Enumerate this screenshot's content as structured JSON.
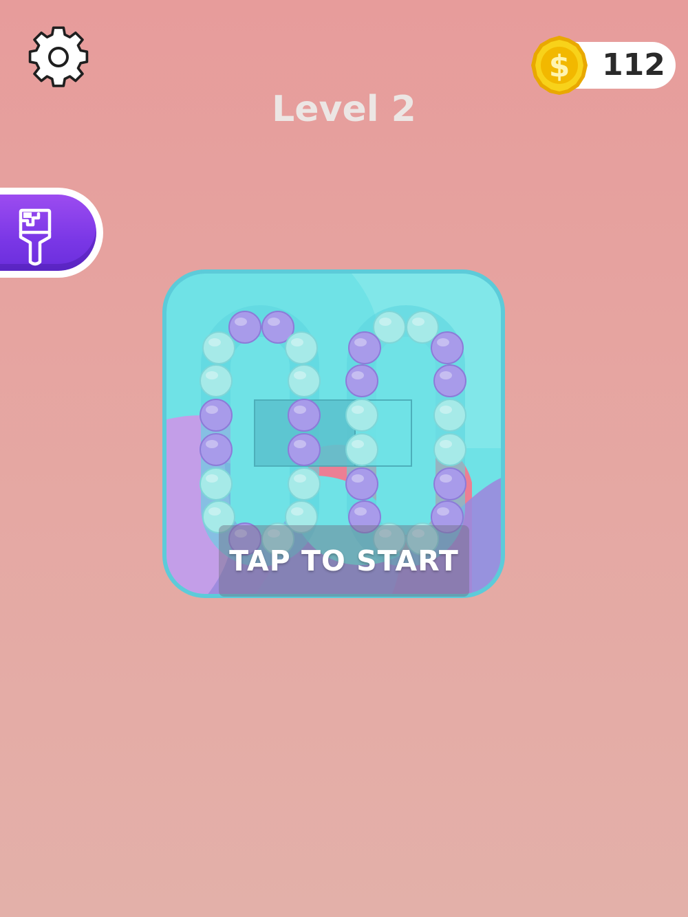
{
  "header": {
    "settings_icon": "gear-icon",
    "coins": "112",
    "coin_icon": "dollar-coin-icon",
    "level_title": "Level 2"
  },
  "skin_button": {
    "icon": "paint-brush-icon"
  },
  "board": {
    "ball_colors": {
      "purple": "#a89bea",
      "teal": "#a6eae8"
    }
  },
  "start": {
    "label": "TAP TO START"
  },
  "colors": {
    "background": "#e79c9b",
    "skin_button": "#8a40ec",
    "board_teal": "#6fe2e6",
    "coin_gold": "#f5c400"
  }
}
